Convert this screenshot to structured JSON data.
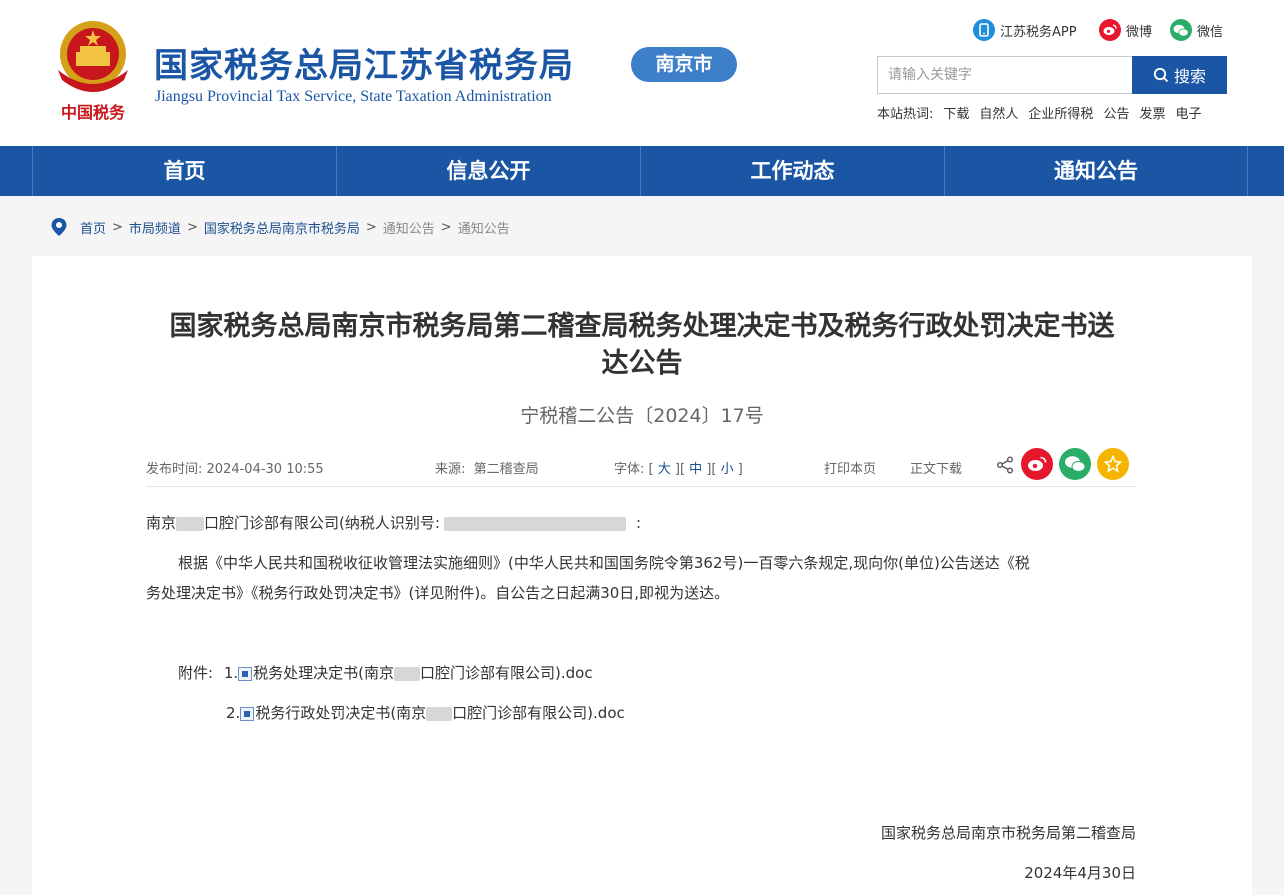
{
  "header": {
    "site_title": "国家税务总局江苏省税务局",
    "site_subtitle": "Jiangsu Provincial Tax Service, State Taxation Administration",
    "city_badge": "南京市",
    "emblem_text": "中国税务",
    "social": [
      {
        "label": "江苏税务APP",
        "icon": "phone-app-icon"
      },
      {
        "label": "微博",
        "icon": "weibo-icon"
      },
      {
        "label": "微信",
        "icon": "wechat-icon"
      }
    ],
    "search": {
      "placeholder": "请输入关键字",
      "button_label": "搜索"
    },
    "hot_label": "本站热词:",
    "hot_words": [
      "下载",
      "自然人",
      "企业所得税",
      "公告",
      "发票",
      "电子"
    ]
  },
  "nav": [
    "首页",
    "信息公开",
    "工作动态",
    "通知公告"
  ],
  "breadcrumb": [
    "首页",
    "市局频道",
    "国家税务总局南京市税务局",
    "通知公告",
    "通知公告"
  ],
  "article": {
    "title_line1": "国家税务总局南京市税务局第二稽查局税务处理决定书及税务行政处罚决定书送",
    "title_line2": "达公告",
    "doc_no": "宁税稽二公告〔2024〕17号",
    "meta": {
      "publish_label": "发布时间:",
      "publish_time": "2024-04-30 10:55",
      "source_label": "来源:",
      "source": "第二稽查局",
      "font_label": "字体:",
      "font_large": "大",
      "font_medium": "中",
      "font_small": "小",
      "print": "打印本页",
      "download": "正文下载"
    },
    "addressee_prefix": "南京",
    "addressee_suffix": "口腔门诊部有限公司(纳税人识别号:",
    "addressee_end": ":",
    "para_line1": "根据《中华人民共和国税收征收管理法实施细则》(中华人民共和国国务院令第362号)一百零六条规定,现向你(单位)公告送达《税",
    "para_line2": "务处理决定书》《税务行政处罚决定书》(详见附件)。自公告之日起满30日,即视为送达。",
    "attach_label": "附件:",
    "attachments": [
      {
        "num": "1.",
        "name_a": "税务处理决定书(南京",
        "name_b": "口腔门诊部有限公司).doc"
      },
      {
        "num": "2.",
        "name_a": "税务行政处罚决定书(南京",
        "name_b": "口腔门诊部有限公司).doc"
      }
    ],
    "signature": "国家税务总局南京市税务局第二稽查局",
    "date": "2024年4月30日"
  },
  "colors": {
    "brand_blue": "#1b56a5",
    "badge_blue": "#3d7fc9",
    "weibo_red": "#e6162d",
    "wechat_green": "#2aae67",
    "fav_yellow": "#f4b400"
  }
}
